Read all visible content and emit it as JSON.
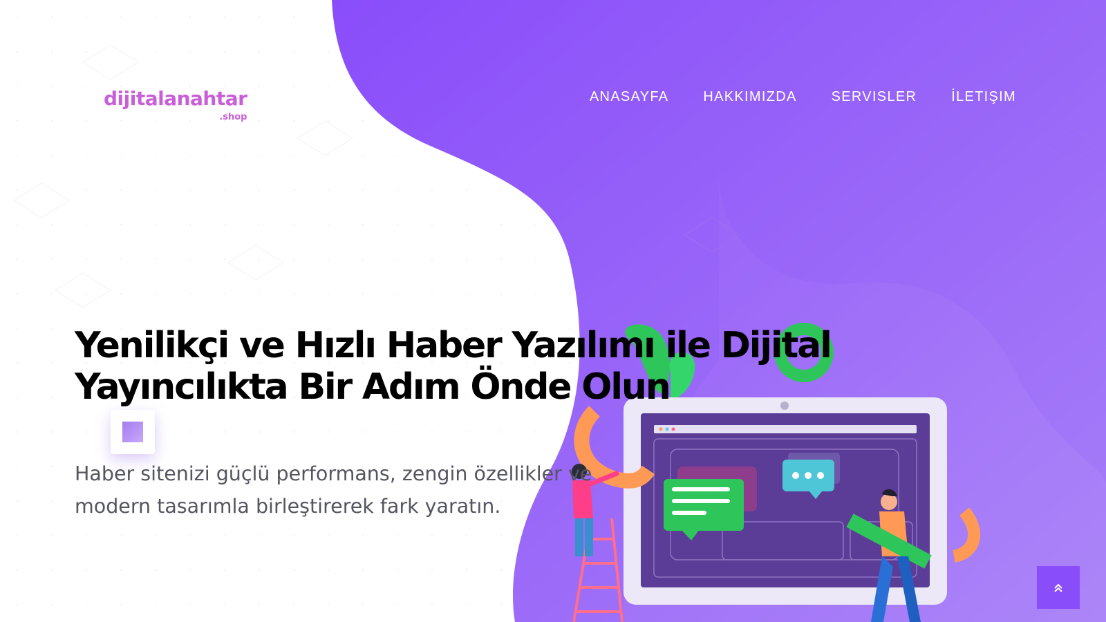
{
  "brand": {
    "name": "dijitalanahtar",
    "suffix": ".shop",
    "color": "#c95fd8"
  },
  "nav": {
    "items": [
      {
        "label": "ANASAYFA"
      },
      {
        "label": "HAKKIMIZDA"
      },
      {
        "label": "SERVISLER"
      },
      {
        "label": "İLETIŞIM"
      }
    ]
  },
  "hero": {
    "title_line1": "Yenilikçi ve Hızlı Haber Yazılımı ile Dijital",
    "title_line2": "Yayıncılıkta Bir Adım Önde Olun",
    "subtitle_line1": "Haber sitenizi güçlü performans, zengin özellikler ve",
    "subtitle_line2": "modern tasarımla birleştirerek fark yaratın."
  },
  "icons": {
    "scroll_top": "double-chevron-up-icon"
  },
  "colors": {
    "accent": "#8a4dfa",
    "blob_light": "#a27bf7",
    "blob_dark": "#8a4dfa",
    "green": "#2ec55a",
    "orange": "#ff9a56"
  }
}
